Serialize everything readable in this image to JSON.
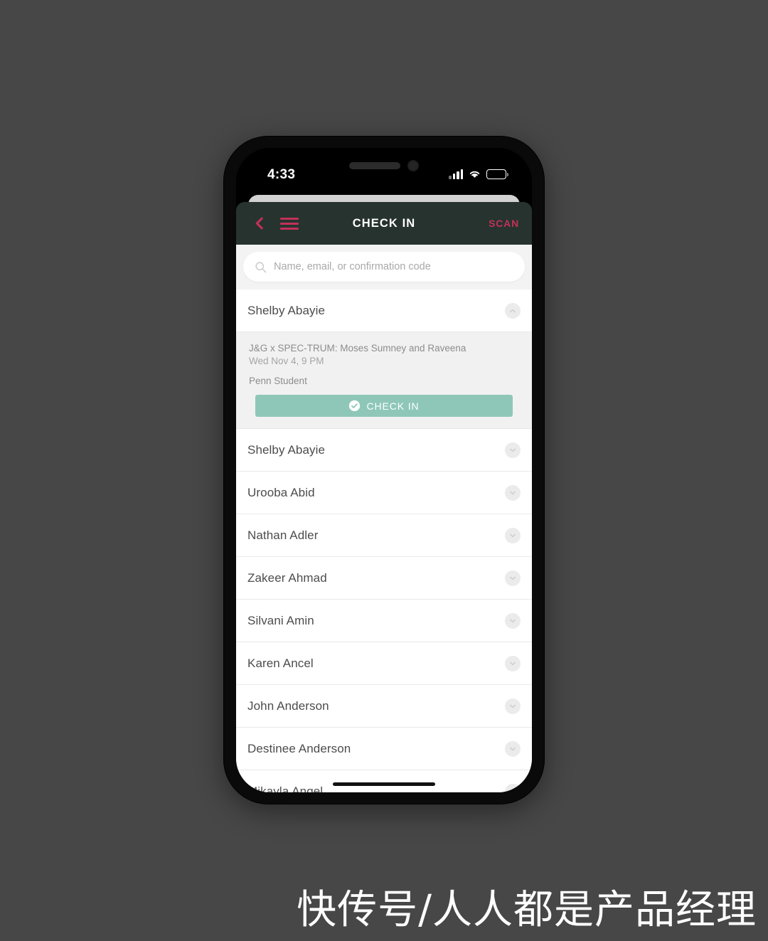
{
  "canvas": {
    "background_color": "#474747",
    "watermark": "快传号/人人都是产品经理"
  },
  "device": {
    "frame_color": "#0a0a0a",
    "status_bar": {
      "time": "4:33",
      "signal_icon": "signal-bars-icon",
      "wifi_icon": "wifi-icon",
      "battery_icon": "battery-icon"
    },
    "home_indicator": "home-indicator"
  },
  "header": {
    "background_color": "#27332f",
    "accent_color": "#c13159",
    "back_icon": "chevron-left-icon",
    "menu_icon": "hamburger-menu-icon",
    "title": "CHECK IN",
    "scan_label": "SCAN"
  },
  "search": {
    "icon": "search-icon",
    "placeholder": "Name, email, or confirmation code",
    "value": ""
  },
  "list": {
    "expanded_index": 0,
    "chevron_down_icon": "chevron-down-icon",
    "chevron_up_icon": "chevron-up-icon",
    "attendees": [
      {
        "name": "Shelby Abayie",
        "expanded": true
      },
      {
        "name": "Shelby Abayie",
        "expanded": false
      },
      {
        "name": "Urooba Abid",
        "expanded": false
      },
      {
        "name": "Nathan Adler",
        "expanded": false
      },
      {
        "name": "Zakeer Ahmad",
        "expanded": false
      },
      {
        "name": "Silvani Amin",
        "expanded": false
      },
      {
        "name": "Karen Ancel",
        "expanded": false
      },
      {
        "name": "John Anderson",
        "expanded": false
      },
      {
        "name": "Destinee Anderson",
        "expanded": false
      },
      {
        "name": "Mikayla Angel",
        "expanded": false
      }
    ]
  },
  "detail": {
    "event_title": "J&G x SPEC-TRUM: Moses Sumney and Raveena",
    "event_date": "Wed Nov 4, 9 PM",
    "ticket_type": "Penn Student",
    "checkin_label": "CHECK IN",
    "checkin_icon": "check-circle-icon",
    "checkin_color": "#8ec7b8"
  }
}
